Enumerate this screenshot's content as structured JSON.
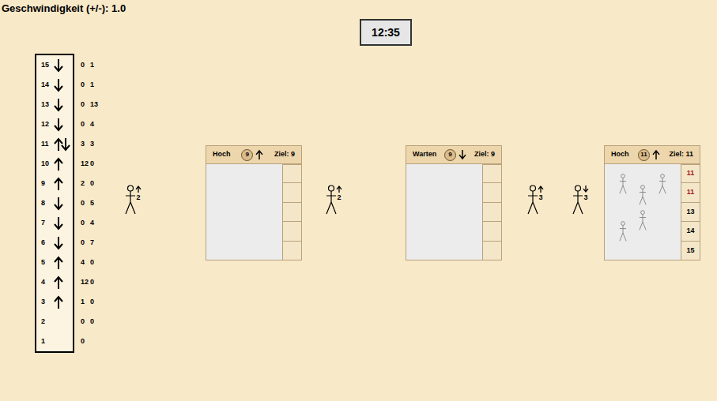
{
  "speed": "Geschwindigkeit (+/-): 1.0",
  "clock": "12:35",
  "floors": [
    {
      "number": "15",
      "up": false,
      "down": true,
      "counts": [
        "0",
        "1"
      ]
    },
    {
      "number": "14",
      "up": false,
      "down": true,
      "counts": [
        "0",
        "1"
      ]
    },
    {
      "number": "13",
      "up": false,
      "down": true,
      "counts": [
        "0",
        "13"
      ]
    },
    {
      "number": "12",
      "up": false,
      "down": true,
      "counts": [
        "0",
        "4"
      ]
    },
    {
      "number": "11",
      "up": true,
      "down": true,
      "counts": [
        "3",
        "3"
      ]
    },
    {
      "number": "10",
      "up": true,
      "down": false,
      "counts": [
        "12",
        "0"
      ]
    },
    {
      "number": "9",
      "up": true,
      "down": false,
      "counts": [
        "2",
        "0"
      ]
    },
    {
      "number": "8",
      "up": false,
      "down": true,
      "counts": [
        "0",
        "5"
      ]
    },
    {
      "number": "7",
      "up": false,
      "down": true,
      "counts": [
        "0",
        "4"
      ]
    },
    {
      "number": "6",
      "up": false,
      "down": true,
      "counts": [
        "0",
        "7"
      ]
    },
    {
      "number": "5",
      "up": true,
      "down": false,
      "counts": [
        "4",
        "0"
      ]
    },
    {
      "number": "4",
      "up": true,
      "down": false,
      "counts": [
        "12",
        "0"
      ]
    },
    {
      "number": "3",
      "up": true,
      "down": false,
      "counts": [
        "1",
        "0"
      ]
    },
    {
      "number": "2",
      "up": false,
      "down": false,
      "counts": [
        "0",
        "0"
      ]
    },
    {
      "number": "1",
      "up": false,
      "down": false,
      "counts": [
        "0"
      ]
    }
  ],
  "scene": [
    {
      "kind": "person",
      "direction": "up",
      "floor": "2"
    },
    {
      "kind": "elevator",
      "status": "Hoch",
      "floor": "9",
      "direction": "up",
      "target": "Ziel: 9",
      "passengers": 0,
      "stops": []
    },
    {
      "kind": "person",
      "direction": "up",
      "floor": "2"
    },
    {
      "kind": "elevator",
      "status": "Warten",
      "floor": "9",
      "direction": "down",
      "target": "Ziel: 9",
      "passengers": 0,
      "stops": []
    },
    {
      "kind": "person",
      "direction": "up",
      "floor": "3"
    },
    {
      "kind": "person",
      "direction": "down",
      "floor": "3"
    },
    {
      "kind": "elevator",
      "status": "Hoch",
      "floor": "11",
      "direction": "up",
      "target": "Ziel: 11",
      "passengers": 5,
      "stops": [
        {
          "floor": "11",
          "current": true
        },
        {
          "floor": "11",
          "current": true
        },
        {
          "floor": "13",
          "current": false
        },
        {
          "floor": "14",
          "current": false
        },
        {
          "floor": "15",
          "current": false
        }
      ]
    }
  ]
}
